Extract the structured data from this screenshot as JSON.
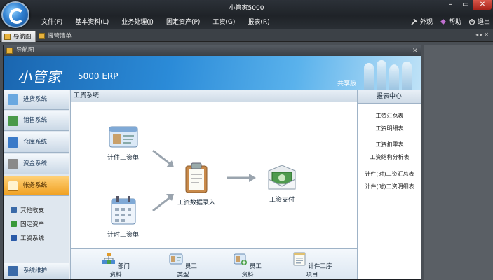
{
  "window": {
    "title": "小管家5000"
  },
  "menu": [
    "文件(F)",
    "基本资料(L)",
    "业务处理(J)",
    "固定资产(P)",
    "工资(G)",
    "报表(R)"
  ],
  "right_menu": [
    {
      "label": "外观",
      "icon": "tools-icon"
    },
    {
      "label": "帮助",
      "icon": "diamond-icon"
    },
    {
      "label": "退出",
      "icon": "power-icon"
    }
  ],
  "tabs": [
    {
      "label": "导航图",
      "active": true
    },
    {
      "label": "报管清单",
      "active": false
    }
  ],
  "inner_window": {
    "title": "导航图"
  },
  "banner": {
    "brand": "小管家",
    "product": "5000 ERP",
    "edition": "共享版"
  },
  "left_nav": [
    {
      "label": "进货系统",
      "icon": "purchase-icon",
      "color": "#6aa8e0",
      "active": false
    },
    {
      "label": "销售系统",
      "icon": "sales-icon",
      "color": "#4a9a4a",
      "active": false
    },
    {
      "label": "仓库系统",
      "icon": "warehouse-icon",
      "color": "#3a7ac8",
      "active": false
    },
    {
      "label": "资金系统",
      "icon": "funds-icon",
      "color": "#8a8a8a",
      "active": false
    },
    {
      "label": "帐务系统",
      "icon": "accounting-icon",
      "color": "#e08a2a",
      "active": true
    }
  ],
  "sub_nav": [
    {
      "label": "其他收支",
      "icon": "income-icon",
      "color": "#3a6aa8"
    },
    {
      "label": "固定资产",
      "icon": "asset-icon",
      "color": "#3a9a3a"
    },
    {
      "label": "工资系统",
      "icon": "payroll-icon",
      "color": "#2a5aa8"
    }
  ],
  "left_nav_bottom": {
    "label": "系统维护",
    "icon": "maintenance-icon",
    "color": "#3a6aa8"
  },
  "center": {
    "header": "工资系统",
    "nodes": {
      "piece_wage": "计件工资单",
      "time_wage": "计时工资单",
      "wage_entry": "工资数据录入",
      "wage_pay": "工资支付"
    },
    "bottom_items": [
      "部门资料",
      "员工类型",
      "员工资料",
      "计件工序项目"
    ]
  },
  "reports": {
    "header": "报表中心",
    "items": [
      "工资汇总表",
      "工资明细表",
      "工资扣零表",
      "工资结构分析表",
      "计件(时)工资汇总表",
      "计件(时)工资明细表"
    ]
  }
}
